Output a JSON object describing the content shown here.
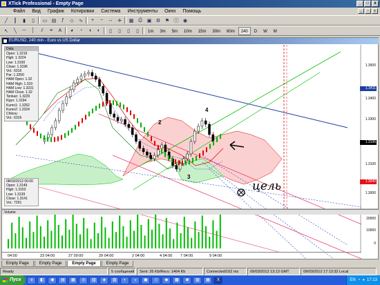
{
  "window": {
    "title": "XTick Professional - Empty Page",
    "min": "_",
    "max": "□",
    "close": "x"
  },
  "menu": [
    "Файл",
    "Вид",
    "График",
    "Котировки",
    "Система",
    "Инструменты",
    "Окно",
    "Помощь"
  ],
  "timeframes": [
    "1m",
    "3m",
    "5m",
    "10m",
    "15m",
    "30m",
    "60m",
    "240",
    "D",
    "W",
    "M"
  ],
  "active_timeframe": "240",
  "chart": {
    "title": "EURUSD, 240 min - Euro vs US Dollar",
    "data_label": "Data",
    "data_lines": [
      "Open: 1.3219",
      "High: 1.3224",
      "Low: 1.3190",
      "Close: 1.3196",
      "Vol.: 6316",
      "",
      "Par: 1.3200",
      "HAM Open: 1.32",
      "HAM High: 1.319",
      "HAM Low: 1.3231",
      "HAM Close: 1.32",
      "Tenkan: 1.3229",
      "Kijun: 1.3194",
      "Kumo1: 1.3252",
      "Kumo2: 1.3324",
      "Chikou: ",
      "Vol.: 6316"
    ],
    "lower_lines": [
      "08/03/2012 00:00",
      "Open: 1.3149",
      "High: 1.3153",
      "Low: 1.3139",
      "Close: 1.3141",
      "Vol.: 7291"
    ],
    "wave_labels": [
      "1",
      "2",
      "3",
      "4"
    ],
    "annotation": "цель",
    "price_labels": [
      {
        "text": "1.3500",
        "bg": "#ffffff",
        "fg": "#000000"
      },
      {
        "text": "1.3411",
        "bg": "#1f3fa0",
        "fg": "#ffffff"
      },
      {
        "text": "1.3400",
        "bg": "#ffffff",
        "fg": "#000000"
      },
      {
        "text": "1.3300",
        "bg": "#ffffff",
        "fg": "#000000"
      },
      {
        "text": "1.3196",
        "bg": "#000000",
        "fg": "#ffffff"
      },
      {
        "text": "1.3100",
        "bg": "#ffffff",
        "fg": "#000000"
      },
      {
        "text": "1.3040",
        "bg": "#e8101a",
        "fg": "#ffffff"
      },
      {
        "text": "1.3000",
        "bg": "#ffffff",
        "fg": "#000000"
      }
    ],
    "volume_label": "Volume",
    "volume_ticks": [
      "20000",
      "10000",
      "0"
    ],
    "date_ticks": [
      "04:00",
      "23 04:00",
      "27 00:00",
      "29 04:00",
      "2 04:00",
      "4 04:00",
      "7 04:00",
      "9 04:00"
    ]
  },
  "tabs": [
    "Empty Page",
    "Empty Page",
    "Empty Page",
    "Empty Page"
  ],
  "active_tab": 2,
  "status": [
    "Ready",
    "5 сообщений",
    "Sent: 26 Kb/Recv: 1464 Kb",
    "Connected/162 ms",
    "09/03/2012 13:13 GMT",
    "09/03/2012 17:13:32 Local"
  ],
  "taskbar": {
    "start": "Пуск",
    "lang": "EN",
    "time": "17:13"
  },
  "colors": {
    "accent": "#0a246a",
    "bull": "#00aa00",
    "bear": "#e8101a",
    "kumo_green": "#00c000",
    "kumo_red": "#e00000",
    "channel": "#e83e6c",
    "trend_blue": "#1f3fa0"
  }
}
